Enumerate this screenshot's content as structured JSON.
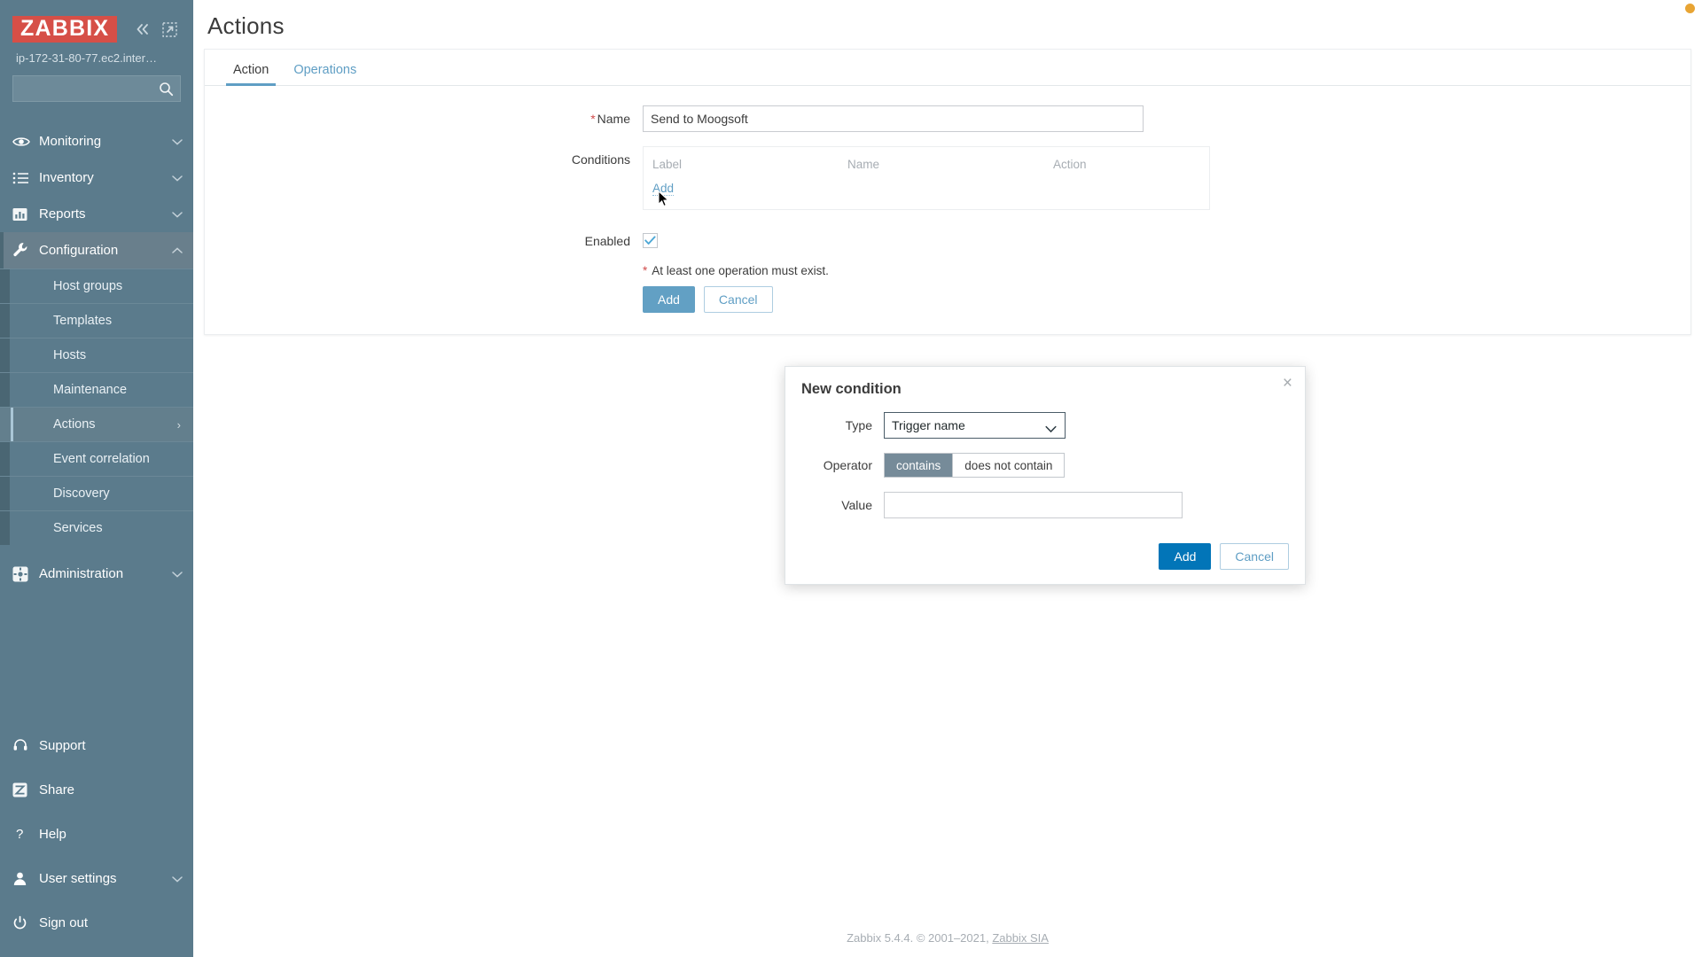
{
  "brand": {
    "logo_text": "ZABBIX",
    "server_name": "ip-172-31-80-77.ec2.inter…",
    "collapse_icon": "double-chevron-left-icon",
    "compact_icon": "collapse-view-icon"
  },
  "search": {
    "value": "",
    "placeholder": "",
    "icon": "search-icon"
  },
  "sidebar": {
    "sections": [
      {
        "label": "Monitoring",
        "icon": "eye-icon",
        "chevron": "chevron-down-icon",
        "active": false
      },
      {
        "label": "Inventory",
        "icon": "list-icon",
        "chevron": "chevron-down-icon",
        "active": false
      },
      {
        "label": "Reports",
        "icon": "bar-chart-icon",
        "chevron": "chevron-down-icon",
        "active": false
      },
      {
        "label": "Configuration",
        "icon": "wrench-icon",
        "chevron": "chevron-up-icon",
        "active": true
      }
    ],
    "submenu": [
      {
        "label": "Host groups",
        "selected": false,
        "chevron": ""
      },
      {
        "label": "Templates",
        "selected": false,
        "chevron": ""
      },
      {
        "label": "Hosts",
        "selected": false,
        "chevron": ""
      },
      {
        "label": "Maintenance",
        "selected": false,
        "chevron": ""
      },
      {
        "label": "Actions",
        "selected": true,
        "chevron": "›"
      },
      {
        "label": "Event correlation",
        "selected": false,
        "chevron": ""
      },
      {
        "label": "Discovery",
        "selected": false,
        "chevron": ""
      },
      {
        "label": "Services",
        "selected": false,
        "chevron": ""
      }
    ],
    "administration": {
      "label": "Administration",
      "icon": "gear-square-icon",
      "chevron": "chevron-down-icon"
    },
    "bottom_items": [
      {
        "label": "Support",
        "icon": "headset-icon",
        "chevron": ""
      },
      {
        "label": "Share",
        "icon": "zabbix-share-icon",
        "chevron": ""
      },
      {
        "label": "Help",
        "icon": "question-mark-icon",
        "chevron": ""
      },
      {
        "label": "User settings",
        "icon": "user-icon",
        "chevron": "chevron-down-icon"
      },
      {
        "label": "Sign out",
        "icon": "power-icon",
        "chevron": ""
      }
    ]
  },
  "page": {
    "title": "Actions"
  },
  "tabs": [
    {
      "label": "Action",
      "active": true
    },
    {
      "label": "Operations",
      "active": false
    }
  ],
  "form": {
    "name_label": "Name",
    "name_required": "*",
    "name_value": "Send to Moogsoft",
    "name_placeholder": "",
    "conditions_label": "Conditions",
    "conditions_columns": [
      "Label",
      "Name",
      "Action"
    ],
    "conditions_rows": [],
    "conditions_add": "Add",
    "enabled_label": "Enabled",
    "enabled_checked": true,
    "hint_required": "*",
    "hint_text": "At least one operation must exist.",
    "submit_label": "Add",
    "cancel_label": "Cancel"
  },
  "modal": {
    "title": "New condition",
    "close_icon": "close-icon",
    "type_label": "Type",
    "type_value": "Trigger name",
    "type_caret": "chevron-down-icon",
    "operator_label": "Operator",
    "operator_options": [
      {
        "label": "contains",
        "selected": true
      },
      {
        "label": "does not contain",
        "selected": false
      }
    ],
    "value_label": "Value",
    "value_value": "",
    "value_placeholder": "",
    "add_label": "Add",
    "cancel_label": "Cancel"
  },
  "footer": {
    "text": "Zabbix 5.4.4. © 2001–2021, ",
    "link": "Zabbix SIA"
  },
  "colors": {
    "sidebar_bg": "#5b7b8c",
    "logo_red": "#d64f47",
    "accent_blue": "#5f9ec4",
    "modal_blue": "#0275b8",
    "required_red": "#d14b4b",
    "segment_on": "#768b99",
    "indicator_orange": "#e8a433"
  }
}
